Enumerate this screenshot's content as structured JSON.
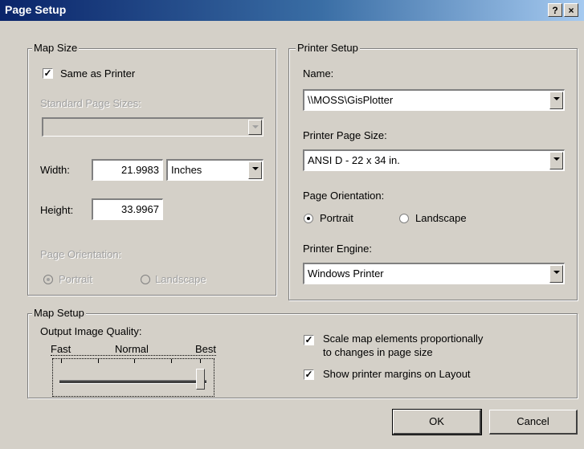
{
  "window": {
    "title": "Page Setup",
    "help_label": "?",
    "close_label": "×"
  },
  "map_size": {
    "legend": "Map Size",
    "same_as_printer_label": "Same as Printer",
    "same_as_printer_checked": true,
    "standard_sizes_label": "Standard Page Sizes:",
    "standard_sizes_value": "",
    "width_label": "Width:",
    "width_value": "21.9983",
    "units_value": "Inches",
    "height_label": "Height:",
    "height_value": "33.9967",
    "orientation_label": "Page Orientation:",
    "portrait_label": "Portrait",
    "landscape_label": "Landscape"
  },
  "printer_setup": {
    "legend": "Printer Setup",
    "name_label": "Name:",
    "name_value": "\\\\MOSS\\GisPlotter",
    "page_size_label": "Printer Page Size:",
    "page_size_value": "ANSI D - 22 x 34 in.",
    "orientation_label": "Page Orientation:",
    "portrait_label": "Portrait",
    "landscape_label": "Landscape",
    "engine_label": "Printer Engine:",
    "engine_value": "Windows Printer"
  },
  "map_setup": {
    "legend": "Map Setup",
    "quality_label": "Output Image Quality:",
    "fast_label": "Fast",
    "normal_label": "Normal",
    "best_label": "Best",
    "quality_level": 1.0,
    "scale_label_line1": "Scale map elements proportionally",
    "scale_label_line2": "to changes in page size",
    "scale_checked": true,
    "margins_label": "Show printer margins on Layout",
    "margins_checked": true
  },
  "buttons": {
    "ok_label": "OK",
    "cancel_label": "Cancel"
  },
  "check_mark": "✓"
}
